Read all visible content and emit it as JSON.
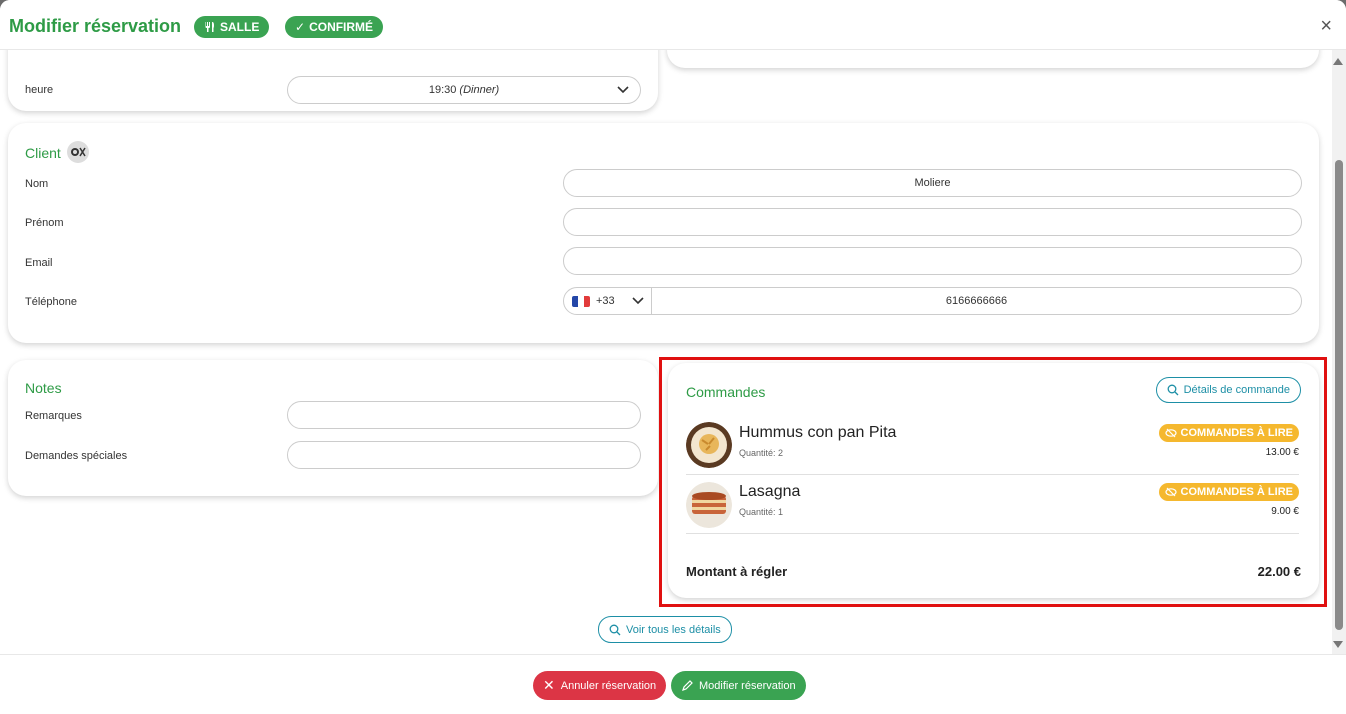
{
  "header": {
    "title": "Modifier réservation",
    "badge_salle": "SALLE",
    "badge_status": "CONFIRMÉ",
    "close": "×"
  },
  "time_section": {
    "label": "heure",
    "value": "19:30",
    "value_suffix": "(Dinner)"
  },
  "client": {
    "title": "Client",
    "nom_label": "Nom",
    "nom_value": "Moliere",
    "prenom_label": "Prénom",
    "prenom_value": "",
    "email_label": "Email",
    "email_value": "",
    "phone_label": "Téléphone",
    "phone_code": "+33",
    "phone_value": "6166666666"
  },
  "notes": {
    "title": "Notes",
    "remarques_label": "Remarques",
    "remarques_value": "",
    "demandes_label": "Demandes spéciales",
    "demandes_value": ""
  },
  "commandes": {
    "title": "Commandes",
    "details_button": "Détails de commande",
    "items": [
      {
        "name": "Hummus con pan Pita",
        "quantity": "Quantité: 2",
        "badge": "COMMANDES À LIRE",
        "price": "13.00 €"
      },
      {
        "name": "Lasagna",
        "quantity": "Quantité: 1",
        "badge": "COMMANDES À LIRE",
        "price": "9.00 €"
      }
    ],
    "total_label": "Montant à régler",
    "total_value": "22.00 €"
  },
  "voir_details": "Voir tous les détails",
  "footer": {
    "cancel_label": "Annuler réservation",
    "modify_label": "Modifier réservation"
  },
  "colors": {
    "green": "#2e9b46",
    "red": "#dc3545",
    "teal": "#1d8fa6",
    "badge_yellow": "#f5b82e",
    "highlight": "#e01010"
  }
}
